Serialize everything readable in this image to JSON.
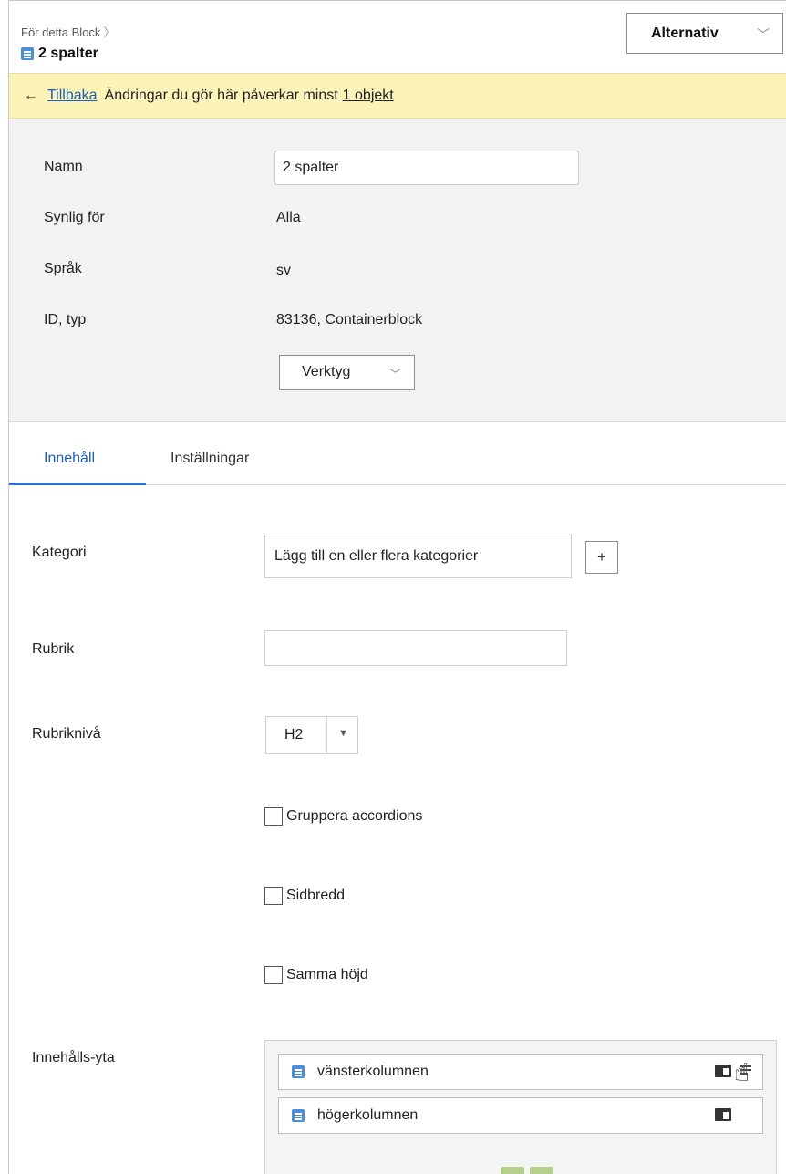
{
  "header": {
    "breadcrumb": "För detta Block",
    "title": "2 spalter",
    "options_button": "Alternativ"
  },
  "banner": {
    "back_link": "Tillbaka",
    "message": "Ändringar du gör här påverkar minst",
    "objects_link": "1 objekt"
  },
  "info": {
    "name_label": "Namn",
    "name_value": "2 spalter",
    "visible_label": "Synlig för",
    "visible_value": "Alla",
    "language_label": "Språk",
    "language_value": "sv",
    "id_label": "ID, typ",
    "id_value": "83136, Containerblock",
    "tools_button": "Verktyg"
  },
  "tabs": [
    {
      "label": "Innehåll",
      "active": true
    },
    {
      "label": "Inställningar",
      "active": false
    }
  ],
  "form": {
    "category_label": "Kategori",
    "category_placeholder": "Lägg till en eller flera kategorier",
    "add_button": "+",
    "heading_label": "Rubrik",
    "heading_value": "",
    "heading_level_label": "Rubriknivå",
    "heading_level_value": "H2",
    "checkboxes": [
      {
        "label": "Gruppera accordions",
        "checked": false
      },
      {
        "label": "Sidbredd",
        "checked": false
      },
      {
        "label": "Samma höjd",
        "checked": false
      }
    ],
    "content_area_label": "Innehålls-yta",
    "content_items": [
      {
        "label": "vänsterkolumnen",
        "icons": [
          "folder-icon",
          "menu-icon"
        ]
      },
      {
        "label": "högerkolumnen",
        "icons": [
          "folder-icon"
        ]
      }
    ]
  },
  "colors": {
    "accent": "#1a5fb4",
    "banner_bg": "#fcf3b8",
    "info_bg": "#f2f2f2",
    "block_icon": "#4a90d9"
  }
}
